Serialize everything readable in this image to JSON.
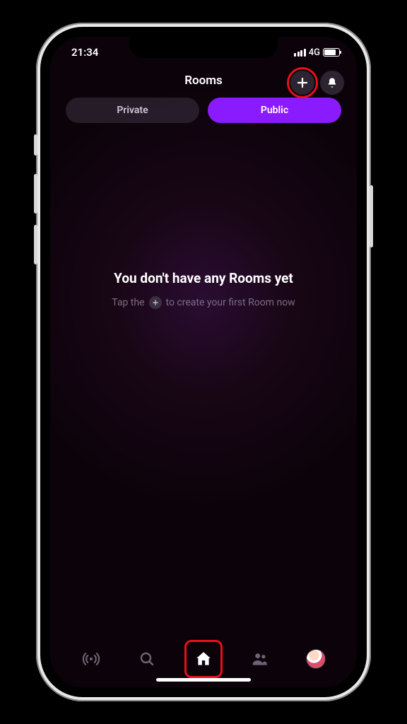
{
  "status": {
    "time": "21:34",
    "network": "4G"
  },
  "header": {
    "title": "Rooms"
  },
  "tabs": {
    "private": "Private",
    "public": "Public"
  },
  "empty": {
    "title": "You don't have any Rooms yet",
    "sub_before": "Tap the",
    "sub_after": "to create your first Room now"
  }
}
